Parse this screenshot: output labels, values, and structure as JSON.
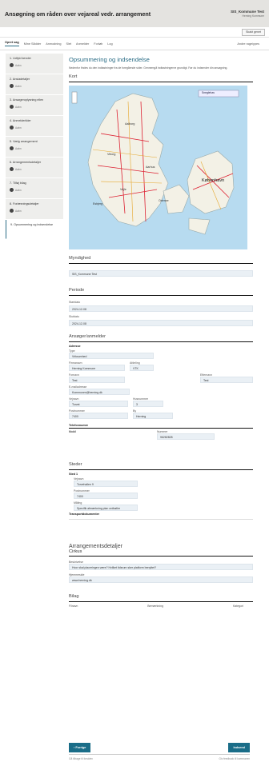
{
  "header": {
    "title": "Ansøgning om råden over vejareal vedr. arrangement",
    "user_name": "SIS_Kommune Test",
    "user_org": "Herning Kommune"
  },
  "subbar": {
    "button": "Skakt genet"
  },
  "topnav": {
    "items": [
      "Opret sag",
      "Mine Sådder",
      "Anmodning",
      "Slet",
      "Anmelder",
      "Forløb",
      "Log"
    ],
    "right": "Andre rageiypes"
  },
  "steps": [
    {
      "label": "1. Udfyld kender",
      "status": "Aabn"
    },
    {
      "label": "2. Ansiadetaljer",
      "status": "Aabn"
    },
    {
      "label": "3. Ansøgeroplysning ellen",
      "status": "Aabn"
    },
    {
      "label": "4. Anmelderilder",
      "status": "Aabn"
    },
    {
      "label": "5. Vælg arrangement",
      "status": "Aabn"
    },
    {
      "label": "6. Arrangementsdetaljer",
      "status": "Aabn"
    },
    {
      "label": "7. Tilføj bilag",
      "status": "Aabn"
    },
    {
      "label": "8. Forlæsningsdetaljer",
      "status": "Aabn"
    },
    {
      "label": "9. Opsummering og indsendelse",
      "status": ""
    }
  ],
  "main": {
    "title": "Opsummering og indsendelse",
    "intro": "Nedenfor findes du den indtastninger fra de foregående sider. Gennemgå indtastningerne grundigt. Før du indsender din ansøgning.",
    "map_heading": "Kort",
    "map_tab": "Sneglehav",
    "map_city": "København",
    "map_towns": [
      "Aalborg",
      "Viborg",
      "Aarhus",
      "Vejle",
      "Esbjerg",
      "Odense"
    ],
    "myndighed_heading": "Myndighed",
    "myndighed_value": "SIS_Kommune Test",
    "periode_heading": "Periode",
    "start_label": "Startdato",
    "start_value": "2024-12-08",
    "slut_label": "Slutdato",
    "slut_value": "2024-12-08",
    "ansoger_heading": "Ansøger/anmelder",
    "adresse_label": "Adresse",
    "type_label": "Type",
    "type_value": "Virksomhed",
    "firma_label": "Firmanavn",
    "firma_value": "Herning Kommune",
    "afdeling_label": "Afdeling",
    "afdeling_value": "VTK",
    "fornavn_label": "Fornavn",
    "fornavn_value": "Test",
    "efternavn_label": "Efternavn",
    "efternavn_value": "Test",
    "email_label": "E-mailadresse",
    "email_value": "Kommunen@herning.dk",
    "vejnavn_label": "Vejnavn",
    "vejnavn_value": "Torvet",
    "husnummer_label": "Husnummer",
    "husnummer_value": "3",
    "postnr_label": "Postnummer",
    "postnr_value": "7400",
    "by_label": "By",
    "by_value": "Herning",
    "telefon_heading": "Telefonnumre",
    "tlf_type_label": "Mobil",
    "tlf_nr_label": "Nummer",
    "tlf_nr_value": "96282828",
    "steder_heading": "Steder",
    "sted_label": "Sted 1",
    "sted_vejnavn_label": "Vejnavn",
    "sted_vejnavn_value": "Torvehallen 9",
    "sted_postnr_label": "Postnummer",
    "sted_postnr_value": "7400",
    "sted_maling_label": "Måling",
    "sted_maling_value": "Specifik afmærkning plan ordbøller",
    "sted_trans_label": "Transportdokumenter",
    "arr_heading": "Arrangementsdetaljer",
    "arr_sub": "Cirkus",
    "arr_q_label": "Beskrivelse",
    "arr_q_value": "Hvor skal placeringen være? Hvilket tidsrum sker platform benyttet?",
    "arr_web_label": "Hjemmeside",
    "arr_web_value": "www.herning.dk",
    "bilag_heading": "Bilag",
    "bilag_cols": [
      "Filnavn",
      "Bemærkning",
      "Kategori"
    ]
  },
  "footer": {
    "prev": "Forrige",
    "submit": "Indsend",
    "bottom_left": "Gå tilbage til forsiden",
    "bottom_right": "Giv feedback til kommunen"
  },
  "colors": {
    "accent": "#2b6d86",
    "button": "#1a6d88",
    "field_bg": "#eaf0f5"
  }
}
